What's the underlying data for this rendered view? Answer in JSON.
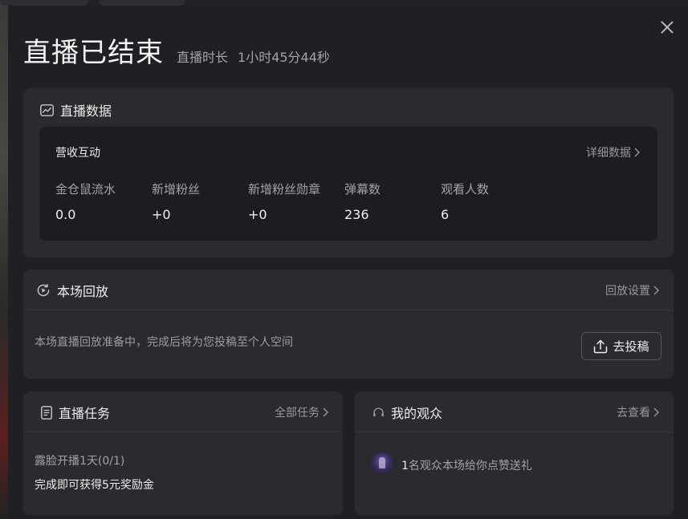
{
  "header": {
    "title": "直播已结束",
    "duration_label": "直播时长",
    "duration_value": "1小时45分44秒"
  },
  "live_data": {
    "title": "直播数据",
    "section_title": "营收互动",
    "detail_link": "详细数据",
    "stats": [
      {
        "label": "金仓鼠流水",
        "value": "0.0"
      },
      {
        "label": "新增粉丝",
        "value": "+0"
      },
      {
        "label": "新增粉丝勋章",
        "value": "+0"
      },
      {
        "label": "弹幕数",
        "value": "236"
      },
      {
        "label": "观看人数",
        "value": "6"
      }
    ]
  },
  "replay": {
    "title": "本场回放",
    "settings_link": "回放设置",
    "description": "本场直播回放准备中，完成后将为您投稿至个人空间",
    "upload_button": "去投稿"
  },
  "tasks": {
    "title": "直播任务",
    "all_link": "全部任务",
    "task_name": "露脸开播1天(0/1)",
    "task_reward": "完成即可获得5元奖励金"
  },
  "audience": {
    "title": "我的观众",
    "view_link": "去查看",
    "count": "1",
    "text": "名观众本场给你点赞送礼"
  },
  "icons": {
    "close": "close-icon",
    "chart": "chart-icon",
    "play": "replay-icon",
    "task": "document-icon",
    "audience": "headset-icon",
    "upload": "upload-icon",
    "chevron": "chevron-right-icon"
  }
}
